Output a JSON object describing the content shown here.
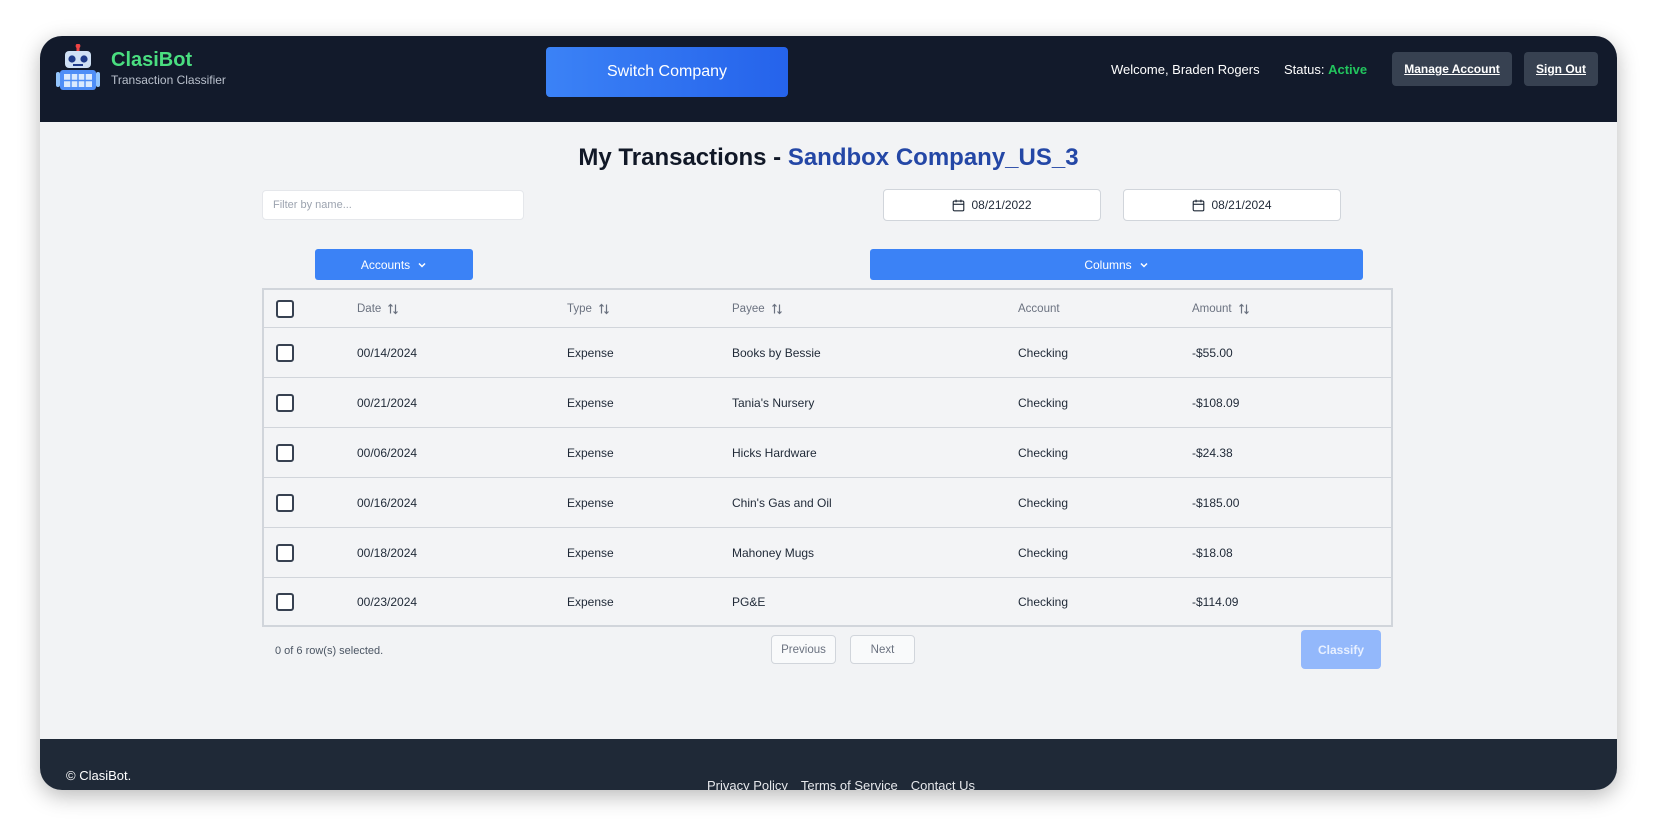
{
  "brand": {
    "name": "ClasiBot",
    "subtitle": "Transaction Classifier"
  },
  "header": {
    "switch_company": "Switch Company",
    "welcome": "Welcome, Braden Rogers",
    "status_label": "Status:",
    "status_value": "Active",
    "manage_account": "Manage Account",
    "sign_out": "Sign Out"
  },
  "page": {
    "title_prefix": "My Transactions - ",
    "company": "Sandbox Company_US_3"
  },
  "filters": {
    "name_placeholder": "Filter by name...",
    "start_date": "08/21/2022",
    "end_date": "08/21/2024",
    "accounts": "Accounts",
    "columns": "Columns"
  },
  "table": {
    "columns": [
      "Date",
      "Type",
      "Payee",
      "Account",
      "Amount"
    ],
    "rows": [
      {
        "date": "00/14/2024",
        "type": "Expense",
        "payee": "Books by Bessie",
        "account": "Checking",
        "amount": "-$55.00"
      },
      {
        "date": "00/21/2024",
        "type": "Expense",
        "payee": "Tania's Nursery",
        "account": "Checking",
        "amount": "-$108.09"
      },
      {
        "date": "00/06/2024",
        "type": "Expense",
        "payee": "Hicks Hardware",
        "account": "Checking",
        "amount": "-$24.38"
      },
      {
        "date": "00/16/2024",
        "type": "Expense",
        "payee": "Chin's Gas and Oil",
        "account": "Checking",
        "amount": "-$185.00"
      },
      {
        "date": "00/18/2024",
        "type": "Expense",
        "payee": "Mahoney Mugs",
        "account": "Checking",
        "amount": "-$18.08"
      },
      {
        "date": "00/23/2024",
        "type": "Expense",
        "payee": "PG&E",
        "account": "Checking",
        "amount": "-$114.09"
      }
    ]
  },
  "pagination": {
    "selected": "0 of 6 row(s) selected.",
    "previous": "Previous",
    "next": "Next",
    "classify": "Classify"
  },
  "footer": {
    "copyright": "© ClasiBot.",
    "links": [
      "Privacy Policy",
      "Terms of Service",
      "Contact Us"
    ]
  },
  "colors": {
    "header_bg": "#121a2b",
    "brand_green": "#4ade80",
    "status_green": "#22c55e",
    "accent_blue": "#3b82f6",
    "company_blue": "#2447a6"
  },
  "icons": [
    "robot-logo-icon",
    "calendar-icon",
    "chevron-down-icon",
    "sort-icon"
  ]
}
